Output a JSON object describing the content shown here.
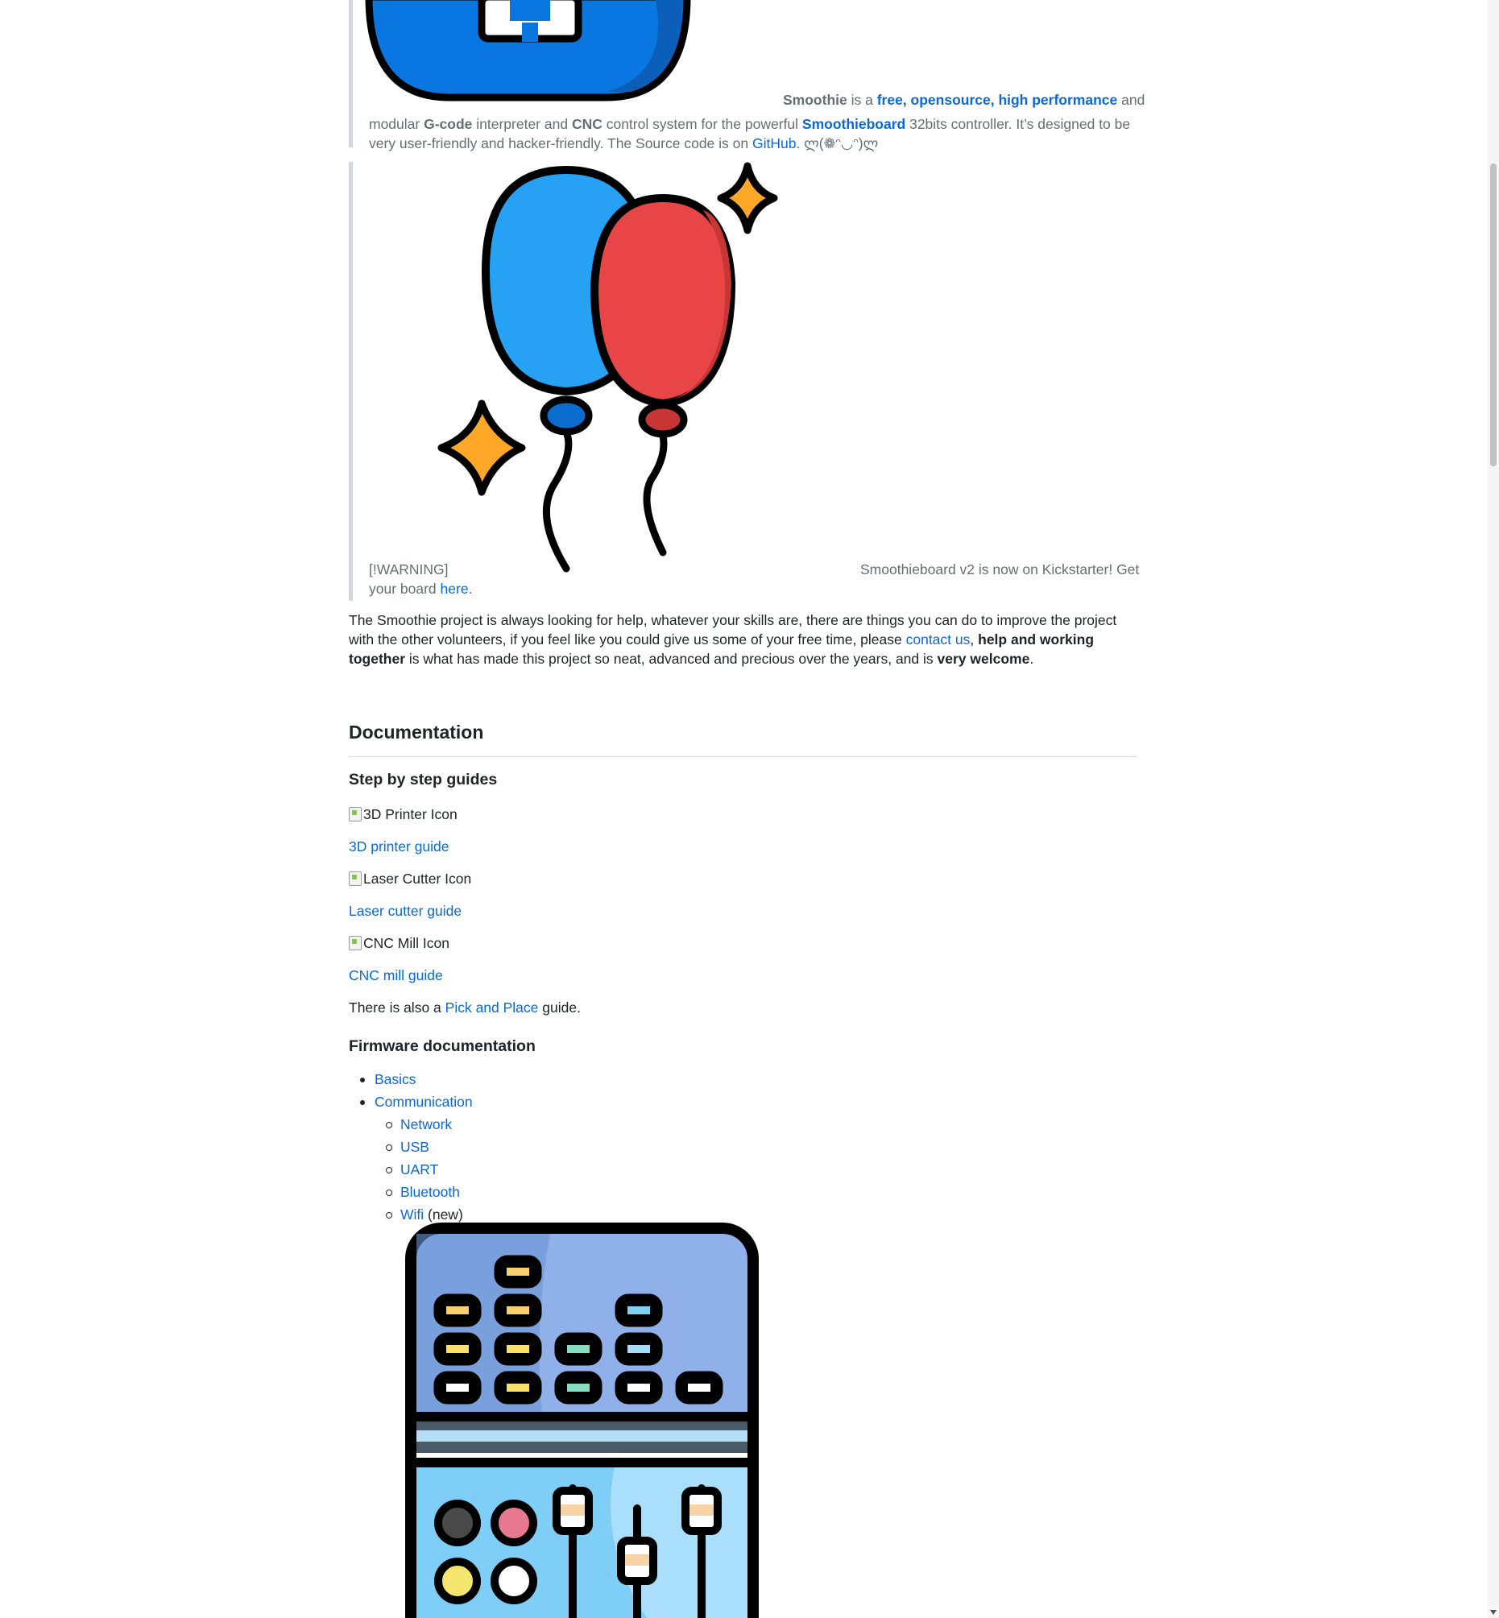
{
  "intro": {
    "smoothie": "Smoothie",
    "is_a": " is a ",
    "free_link": "free, opensource, high performance",
    "and1": " and",
    "modular": "modular ",
    "gcode": "G-code",
    "interp": " interpreter and ",
    "cnc": "CNC",
    "control": " control system for the powerful ",
    "smoothieboard_link": "Smoothieboard",
    "controller": " 32bits controller. It’s designed to be very user-friendly and hacker-friendly. The Source code is on ",
    "github_link": "GitHub",
    "emoticon": ". ლ(❁ᵔ◡ᵔ)ლ"
  },
  "warning": {
    "tag": "[!WARNING]",
    "text": "Smoothieboard v2 is now on Kickstarter! Get",
    "text2": "your board ",
    "here_link": "here",
    "period": "."
  },
  "help_paragraph": {
    "p1": "The Smoothie project is always looking for help, whatever your skills are, there are things you can do to improve the project with the other volunteers, if you feel like you could give us some of your free time, please ",
    "contact_link": "contact us",
    "comma": ", ",
    "bold1": "help and working together",
    "p2": " is what has made this project so neat, advanced and precious over the years, and is ",
    "bold2": "very welcome",
    "end": "."
  },
  "documentation": {
    "heading": "Documentation",
    "guides_heading": "Step by step guides",
    "printer_icon_alt": "3D Printer Icon",
    "printer_link": "3D printer guide",
    "laser_icon_alt": "Laser Cutter Icon",
    "laser_link": "Laser cutter guide",
    "cnc_icon_alt": "CNC Mill Icon",
    "cnc_link": "CNC mill guide",
    "also_prefix": "There is also a ",
    "pnp_link": "Pick and Place",
    "also_suffix": " guide.",
    "firmware_heading": "Firmware documentation",
    "items": [
      "Basics",
      "Communication"
    ],
    "comm_items": [
      "Network",
      "USB",
      "UART",
      "Bluetooth",
      "Wifi"
    ],
    "wifi_note": " (new)"
  },
  "colors": {
    "link": "#0969da",
    "quote_text": "#656d76",
    "balloon_blue": "#26a1f4",
    "balloon_red": "#e84646",
    "sparkle": "#ffa726"
  }
}
